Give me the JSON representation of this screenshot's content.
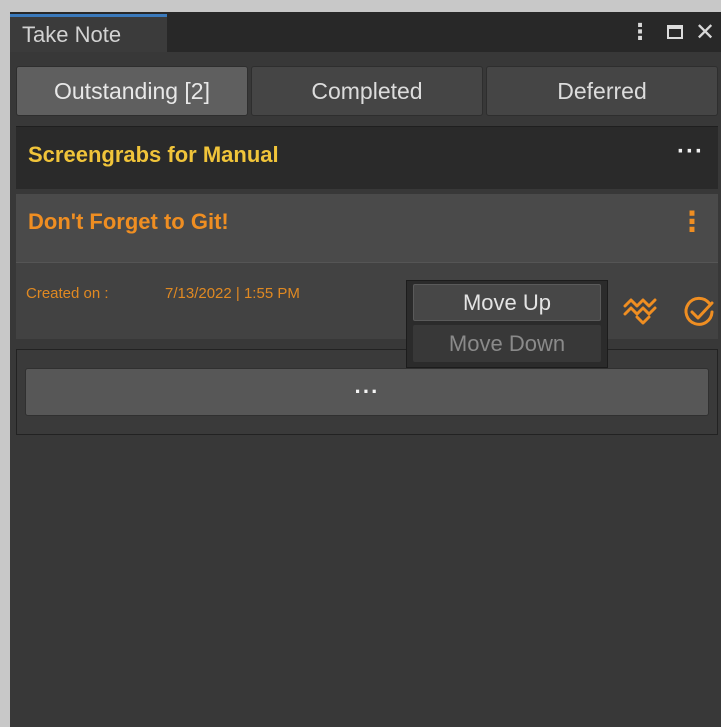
{
  "window": {
    "tab_title": "Take Note",
    "menu_icon": "kebab-vertical-icon",
    "maximize_icon": "maximize-icon",
    "close_icon": "close-icon",
    "close_glyph": "✕",
    "menu_glyph": "⋮"
  },
  "tabs": [
    {
      "label": "Outstanding [2]",
      "active": true
    },
    {
      "label": "Completed",
      "active": false
    },
    {
      "label": "Deferred",
      "active": false
    }
  ],
  "group": {
    "title": "Screengrabs for Manual",
    "more_label": "···"
  },
  "note": {
    "title": "Don't Forget to Git!",
    "menu_label": "⋮",
    "created_label": "Created on :",
    "created_value": "7/13/2022 | 1:55 PM",
    "reorder_icon": "reorder-icon",
    "complete_icon": "check-circle-icon"
  },
  "context_menu": {
    "items": [
      {
        "label": "Move Up",
        "enabled": true
      },
      {
        "label": "Move Down",
        "enabled": false
      }
    ]
  },
  "add_button": {
    "label": "···"
  },
  "colors": {
    "accent_tab": "#3a79bb",
    "group_title": "#f0c43a",
    "note_orange": "#ef8e22"
  }
}
